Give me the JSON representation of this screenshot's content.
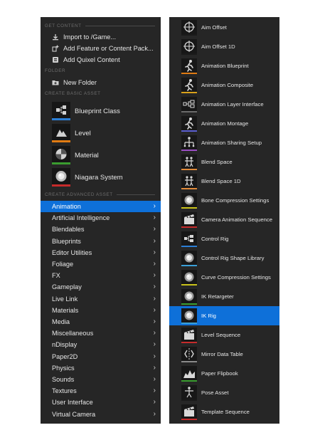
{
  "left_menu": {
    "sections": {
      "get_content": "GET CONTENT",
      "folder": "FOLDER",
      "create_basic": "CREATE BASIC ASSET",
      "create_advanced": "CREATE ADVANCED ASSET"
    },
    "get_content_items": [
      {
        "label": "Import to /Game...",
        "icon": "import-icon"
      },
      {
        "label": "Add Feature or Content Pack...",
        "icon": "add-feature-icon"
      },
      {
        "label": "Add Quixel Content",
        "icon": "quixel-icon"
      }
    ],
    "folder_items": [
      {
        "label": "New Folder",
        "icon": "new-folder-icon"
      }
    ],
    "basic_assets": [
      {
        "label": "Blueprint Class",
        "icon": "blueprint-class-icon",
        "color": "#2c7fd6"
      },
      {
        "label": "Level",
        "icon": "level-icon",
        "color": "#e07b13"
      },
      {
        "label": "Material",
        "icon": "material-icon",
        "color": "#3a9c2f"
      },
      {
        "label": "Niagara System",
        "icon": "niagara-icon",
        "color": "#c62b2b"
      }
    ],
    "categories": [
      {
        "label": "Animation",
        "selected": true
      },
      {
        "label": "Artificial Intelligence"
      },
      {
        "label": "Blendables"
      },
      {
        "label": "Blueprints"
      },
      {
        "label": "Editor Utilities"
      },
      {
        "label": "Foliage"
      },
      {
        "label": "FX"
      },
      {
        "label": "Gameplay"
      },
      {
        "label": "Live Link"
      },
      {
        "label": "Materials"
      },
      {
        "label": "Media"
      },
      {
        "label": "Miscellaneous"
      },
      {
        "label": "nDisplay"
      },
      {
        "label": "Paper2D"
      },
      {
        "label": "Physics"
      },
      {
        "label": "Sounds"
      },
      {
        "label": "Textures"
      },
      {
        "label": "User Interface"
      },
      {
        "label": "Virtual Camera"
      }
    ],
    "chevron": "›"
  },
  "right_menu": {
    "items": [
      {
        "label": "Aim Offset",
        "icon": "aim-offset-icon",
        "color": "#1a1a1a"
      },
      {
        "label": "Aim Offset 1D",
        "icon": "aim-offset-1d-icon",
        "color": "#1a1a1a"
      },
      {
        "label": "Animation Blueprint",
        "icon": "animation-blueprint-icon",
        "color": "#e07b13"
      },
      {
        "label": "Animation Composite",
        "icon": "animation-composite-icon",
        "color": "#d9a21a"
      },
      {
        "label": "Animation Layer Interface",
        "icon": "animation-layer-interface-icon",
        "color": "#6a6a6a"
      },
      {
        "label": "Animation Montage",
        "icon": "animation-montage-icon",
        "color": "#5b5fd0"
      },
      {
        "label": "Animation Sharing Setup",
        "icon": "animation-sharing-setup-icon",
        "color": "#9a4dc4"
      },
      {
        "label": "Blend Space",
        "icon": "blend-space-icon",
        "color": "#e08a3a"
      },
      {
        "label": "Blend Space 1D",
        "icon": "blend-space-1d-icon",
        "color": "#e08a3a"
      },
      {
        "label": "Bone Compression Settings",
        "icon": "bone-compression-settings-icon",
        "color": "#c9c21a"
      },
      {
        "label": "Camera Animation Sequence",
        "icon": "camera-animation-sequence-icon",
        "color": "#c62b2b"
      },
      {
        "label": "Control Rig",
        "icon": "control-rig-icon",
        "color": "#2c7fd6"
      },
      {
        "label": "Control Rig Shape Library",
        "icon": "control-rig-shape-library-icon",
        "color": "#3aa0d8"
      },
      {
        "label": "Curve Compression Settings",
        "icon": "curve-compression-settings-icon",
        "color": "#c9c21a"
      },
      {
        "label": "IK Retargeter",
        "icon": "ik-retargeter-icon",
        "color": "#3a9c2f"
      },
      {
        "label": "IK Rig",
        "icon": "ik-rig-icon",
        "color": "#3aa0d8",
        "selected": true
      },
      {
        "label": "Level Sequence",
        "icon": "level-sequence-icon",
        "color": "#c62b2b"
      },
      {
        "label": "Mirror Data Table",
        "icon": "mirror-data-table-icon",
        "color": "#8a8a8a"
      },
      {
        "label": "Paper Flipbook",
        "icon": "paper-flipbook-icon",
        "color": "#3a9c2f"
      },
      {
        "label": "Pose Asset",
        "icon": "pose-asset-icon",
        "color": "#1a1a1a"
      },
      {
        "label": "Template Sequence",
        "icon": "template-sequence-icon",
        "color": "#c62b2b"
      }
    ]
  }
}
